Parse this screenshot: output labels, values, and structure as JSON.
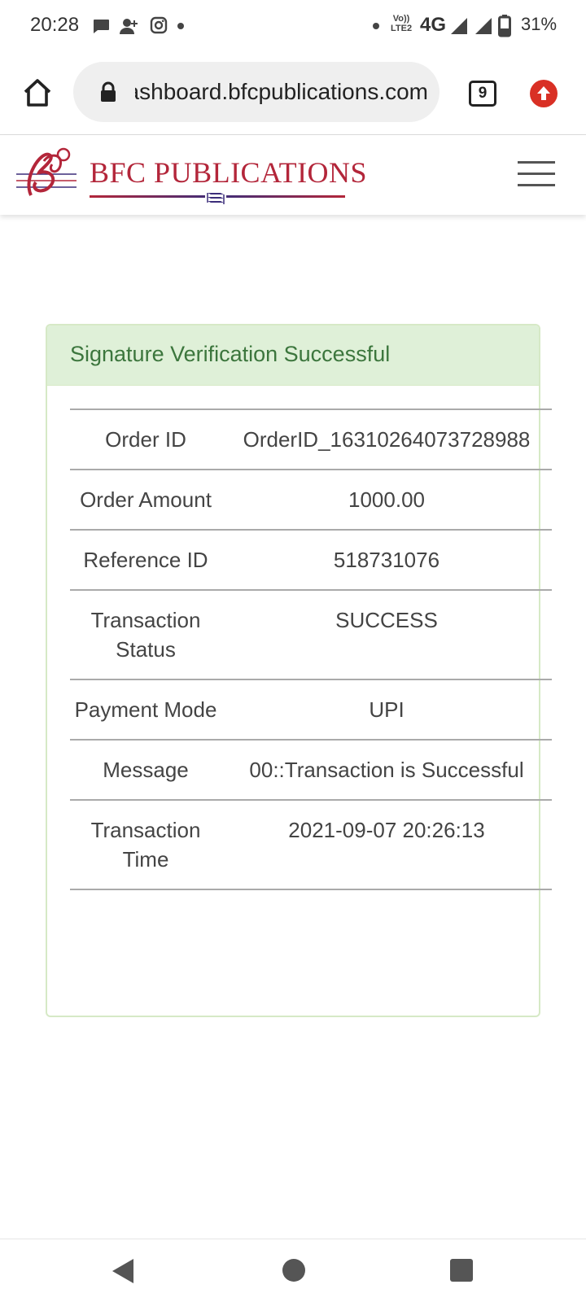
{
  "status_bar": {
    "time": "20:28",
    "network": "4G",
    "volte_label_top": "Vo))",
    "volte_label_bottom": "LTE2",
    "battery": "31%",
    "icons": [
      "chat-icon",
      "person-add-icon",
      "instagram-icon",
      "dot-icon",
      "dot-icon",
      "signal-icon",
      "signal-icon",
      "battery-icon"
    ]
  },
  "browser": {
    "url": "dashboard.bfcpublications.com",
    "tab_count": "9",
    "icons": [
      "home-icon",
      "lock-icon",
      "tabs-icon",
      "upload-arrow-icon"
    ],
    "upload_color": "#d93025"
  },
  "site": {
    "brand": "BFC PUBLICATIONS",
    "brand_color": "#b3263a",
    "icons": [
      "logo-icon",
      "books-icon",
      "hamburger-menu-icon"
    ]
  },
  "card": {
    "title": "Signature Verification Successful",
    "header_bg": "#dff0d8",
    "header_text_color": "#3c763d",
    "rows": [
      {
        "label": "Order ID",
        "value": "OrderID_16310264073728988"
      },
      {
        "label": "Order Amount",
        "value": "1000.00"
      },
      {
        "label": "Reference ID",
        "value": "518731076"
      },
      {
        "label": "Transaction Status",
        "value": "SUCCESS"
      },
      {
        "label": "Payment Mode",
        "value": "UPI"
      },
      {
        "label": "Message",
        "value": "00::Transaction is Successful"
      },
      {
        "label": "Transaction Time",
        "value": "2021-09-07 20:26:13"
      }
    ]
  },
  "nav_bar": {
    "icons": [
      "back-icon",
      "home-circle-icon",
      "recents-icon"
    ]
  }
}
